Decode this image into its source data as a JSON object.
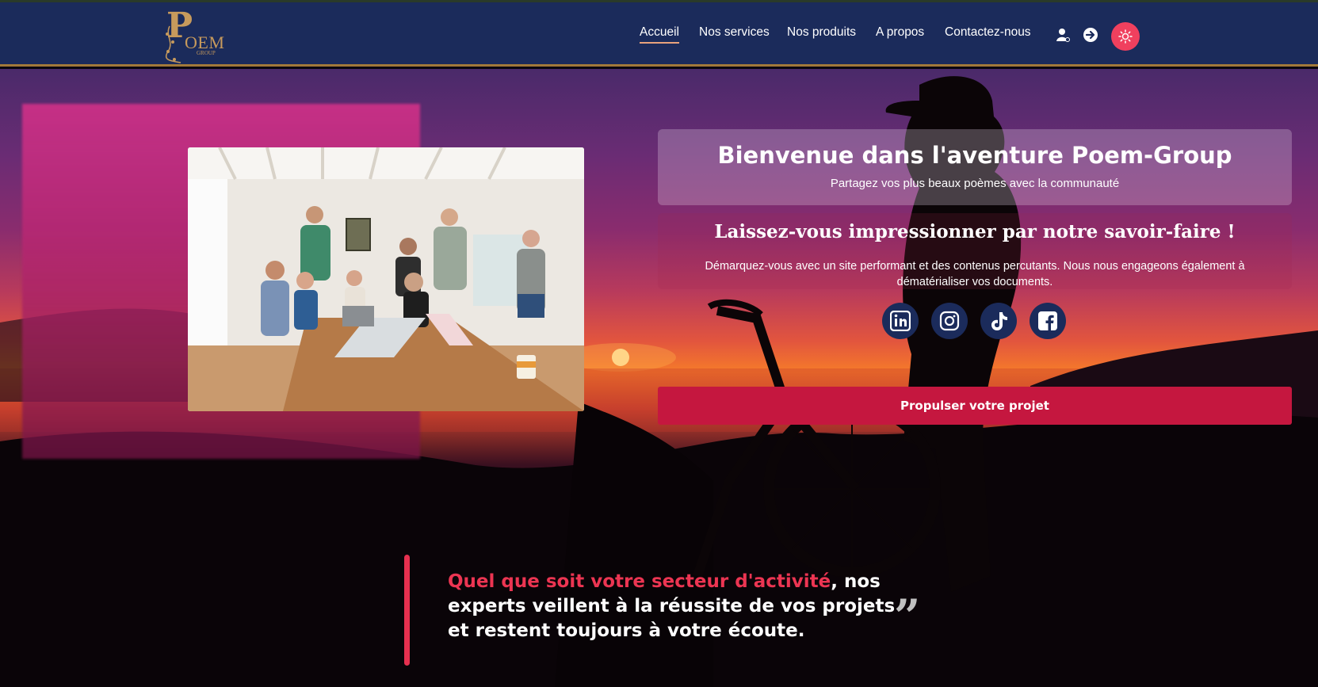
{
  "brand": {
    "logo_letter": "P",
    "logo_rest": "OEM",
    "logo_sub": "GROUP"
  },
  "nav": {
    "items": [
      {
        "label": "Accueil",
        "active": true
      },
      {
        "label": "Nos services"
      },
      {
        "label": "Nos produits"
      },
      {
        "label": "A propos"
      },
      {
        "label": "Contactez-nous"
      }
    ],
    "icons": [
      "user-icon",
      "login-icon",
      "sun-icon"
    ]
  },
  "hero": {
    "welcome_title": "Bienvenue dans l'aventure Poem-Group",
    "welcome_subtitle": "Partagez vos plus beaux poèmes avec la communauté",
    "info_title": "Laissez-vous impressionner par notre savoir-faire !",
    "info_text": "Démarquez-vous avec un site performant et des contenus percutants. Nous nous engageons également à dématérialiser vos documents.",
    "cta_label": "Propulser votre projet",
    "social": [
      "linkedin-icon",
      "instagram-icon",
      "tiktok-icon",
      "facebook-icon"
    ]
  },
  "quote": {
    "highlight": "Quel que soit votre secteur d'activité",
    "rest": ", nos experts veillent à la réussite de vos projets et restent toujours à votre écoute.",
    "mark": "”"
  },
  "colors": {
    "navbar": "#1b2b5b",
    "accent": "#c5173f",
    "theme_button": "#f0405e",
    "highlight": "#ec3552",
    "gold": "#c79a5c"
  }
}
